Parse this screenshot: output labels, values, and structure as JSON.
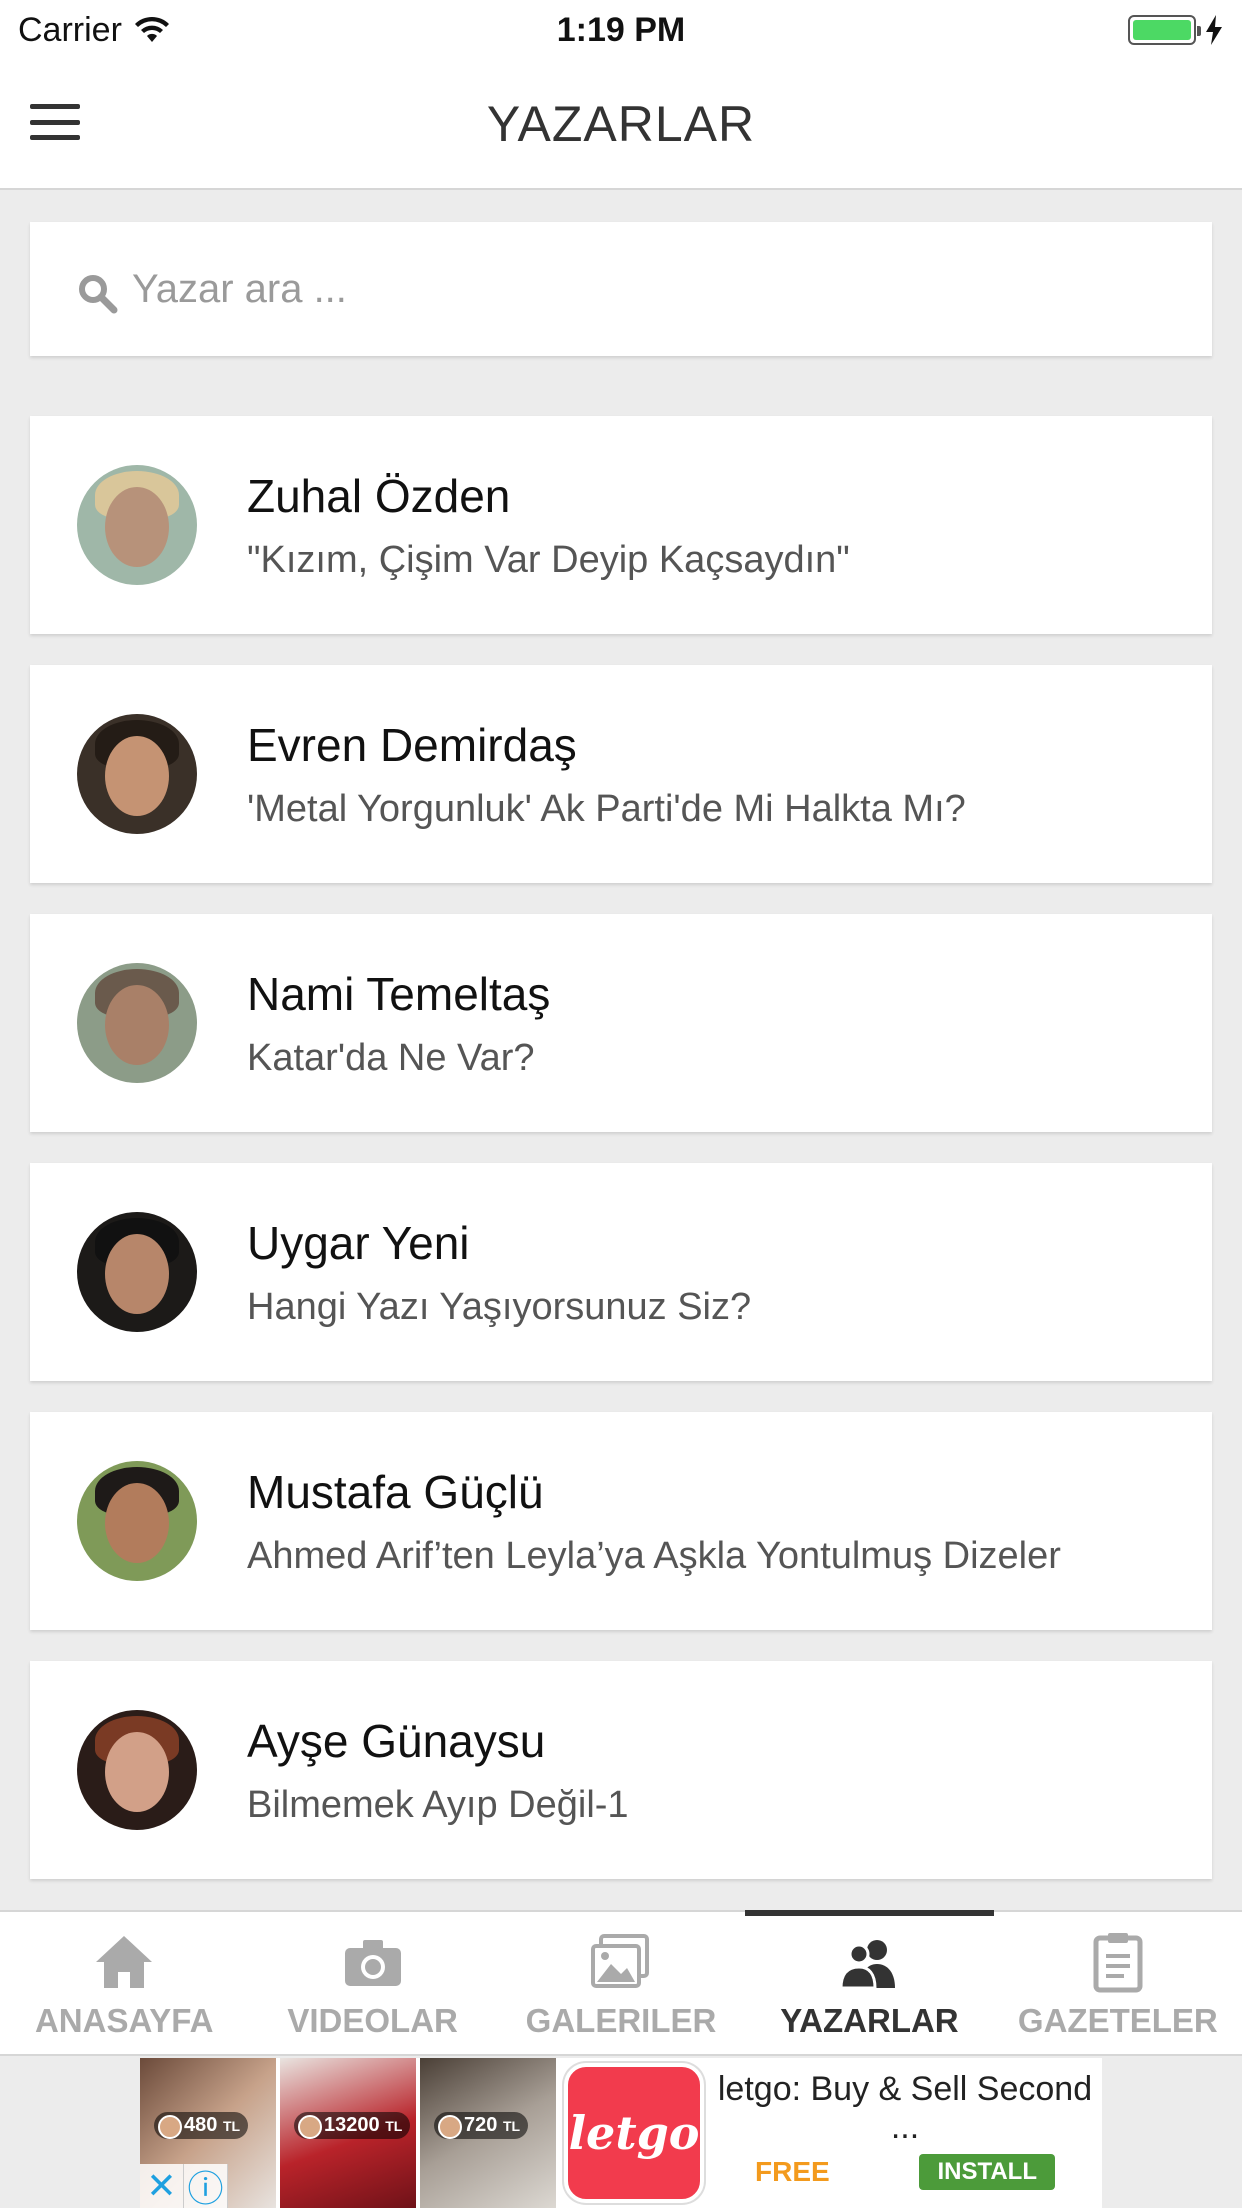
{
  "status_bar": {
    "carrier": "Carrier",
    "time": "1:19 PM",
    "battery_level": 1.0
  },
  "nav": {
    "title": "YAZARLAR",
    "menu_icon": "hamburger-menu-icon"
  },
  "search": {
    "placeholder": "Yazar ara ...",
    "value": "",
    "icon": "search-icon"
  },
  "authors": [
    {
      "name": "Zuhal Özden",
      "article": "\"Kızım, Çişim Var Deyip Kaçsaydın\""
    },
    {
      "name": "Evren Demirdaş",
      "article": "'Metal Yorgunluk' Ak Parti'de Mi Halkta Mı?"
    },
    {
      "name": "Nami Temeltaş",
      "article": "Katar'da Ne Var?"
    },
    {
      "name": "Uygar Yeni",
      "article": "Hangi Yazı Yaşıyorsunuz Siz?"
    },
    {
      "name": "Mustafa Güçlü",
      "article": "Ahmed Arif’ten Leyla’ya Aşkla Yontulmuş Dizeler"
    },
    {
      "name": "Ayşe Günaysu",
      "article": "Bilmemek Ayıp Değil-1"
    }
  ],
  "tabs": [
    {
      "label": "ANASAYFA",
      "icon": "home-icon",
      "active": false
    },
    {
      "label": "VIDEOLAR",
      "icon": "camera-icon",
      "active": false
    },
    {
      "label": "GALERILER",
      "icon": "gallery-icon",
      "active": false
    },
    {
      "label": "YAZARLAR",
      "icon": "users-icon",
      "active": true
    },
    {
      "label": "GAZETELER",
      "icon": "clipboard-icon",
      "active": false
    }
  ],
  "ad": {
    "prices": [
      "480",
      "13200",
      "720"
    ],
    "currency": "TL",
    "logo_text": "letgo",
    "title": "letgo: Buy & Sell Second ...",
    "price_label": "FREE",
    "cta": "INSTALL"
  },
  "colors": {
    "active_tab": "#333333",
    "inactive_tab": "#aaaaaa",
    "ad_logo": "#f23b4d",
    "install_button": "#4c9b3a",
    "free_label": "#f39a1d"
  }
}
